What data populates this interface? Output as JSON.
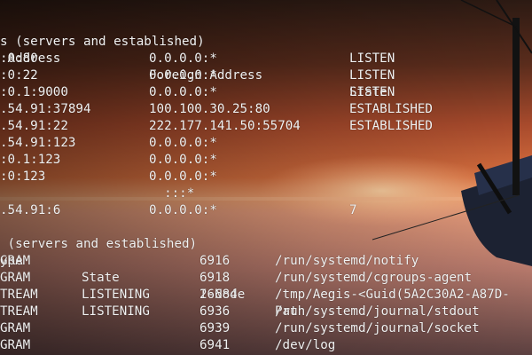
{
  "terminal": {
    "inet_section": {
      "heading": "s (servers and established)",
      "headers": {
        "local": " Address",
        "foreign": "Foreign Address",
        "state": "State"
      },
      "rows": [
        {
          "local": ":0:80",
          "foreign": "0.0.0.0:*",
          "state": "LISTEN"
        },
        {
          "local": ":0:22",
          "foreign": "0.0.0.0:*",
          "state": "LISTEN"
        },
        {
          "local": ":0.1:9000",
          "foreign": "0.0.0.0:*",
          "state": "LISTEN"
        },
        {
          "local": ".54.91:37894",
          "foreign": "100.100.30.25:80",
          "state": "ESTABLISHED"
        },
        {
          "local": ".54.91:22",
          "foreign": "222.177.141.50:55704",
          "state": "ESTABLISHED"
        },
        {
          "local": ".54.91:123",
          "foreign": "0.0.0.0:*",
          "state": ""
        },
        {
          "local": ":0.1:123",
          "foreign": "0.0.0.0:*",
          "state": ""
        },
        {
          "local": ":0:123",
          "foreign": "0.0.0.0:*",
          "state": ""
        },
        {
          "local": "",
          "foreign": "  :::*",
          "state": ""
        },
        {
          "local": ".54.91:6",
          "foreign": "0.0.0.0:*",
          "state": "7"
        }
      ]
    },
    "unix_section": {
      "heading": " (servers and established)",
      "headers": {
        "type": "ype",
        "state": "State",
        "inode": "I-Node",
        "path": "Path"
      },
      "rows": [
        {
          "type": "GRAM",
          "state": "",
          "inode": "6916",
          "path": "/run/systemd/notify"
        },
        {
          "type": "GRAM",
          "state": "",
          "inode": "6918",
          "path": "/run/systemd/cgroups-agent"
        },
        {
          "type": "TREAM",
          "state": "LISTENING",
          "inode": "26684",
          "path": "/tmp/Aegis-<Guid(5A2C30A2-A87D-"
        },
        {
          "type": "TREAM",
          "state": "LISTENING",
          "inode": "6936",
          "path": "/run/systemd/journal/stdout"
        },
        {
          "type": "GRAM",
          "state": "",
          "inode": "6939",
          "path": "/run/systemd/journal/socket"
        },
        {
          "type": "GRAM",
          "state": "",
          "inode": "6941",
          "path": "/dev/log"
        }
      ]
    }
  },
  "colors": {
    "text": "#f2f2f2",
    "sky_top": "#2a1a14",
    "sky_mid": "#c85a35",
    "horizon": "#f0a070",
    "sea": "#b87a6a"
  }
}
